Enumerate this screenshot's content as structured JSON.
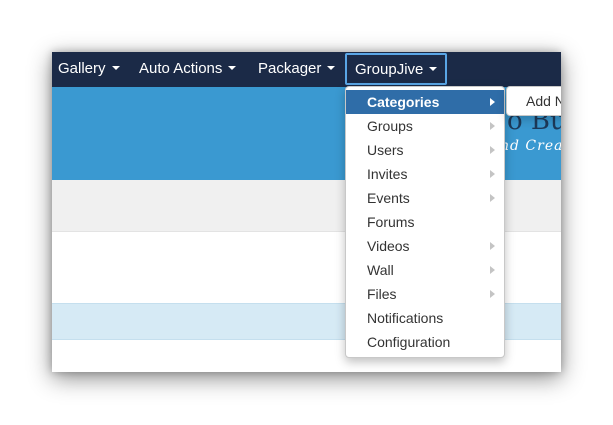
{
  "navbar": {
    "items": [
      {
        "label": "Gallery"
      },
      {
        "label": "Auto Actions"
      },
      {
        "label": "Packager"
      },
      {
        "label": "GroupJive"
      }
    ]
  },
  "banner": {
    "title": "o Bus",
    "tagline": "nd Crea"
  },
  "dropdown": {
    "items": [
      {
        "label": "Categories",
        "has_submenu": true,
        "selected": true
      },
      {
        "label": "Groups",
        "has_submenu": true
      },
      {
        "label": "Users",
        "has_submenu": true
      },
      {
        "label": "Invites",
        "has_submenu": true
      },
      {
        "label": "Events",
        "has_submenu": true
      },
      {
        "label": "Forums",
        "has_submenu": false
      },
      {
        "label": "Videos",
        "has_submenu": true
      },
      {
        "label": "Wall",
        "has_submenu": true
      },
      {
        "label": "Files",
        "has_submenu": true
      },
      {
        "label": "Notifications",
        "has_submenu": false
      },
      {
        "label": "Configuration",
        "has_submenu": false
      }
    ]
  },
  "submenu": {
    "items": [
      {
        "label": "Add N"
      }
    ]
  },
  "colors": {
    "navbar_bg": "#1b2a47",
    "banner_bg": "#3a99d1",
    "selected_bg": "#2f6da8",
    "active_border": "#5aa6e6"
  }
}
